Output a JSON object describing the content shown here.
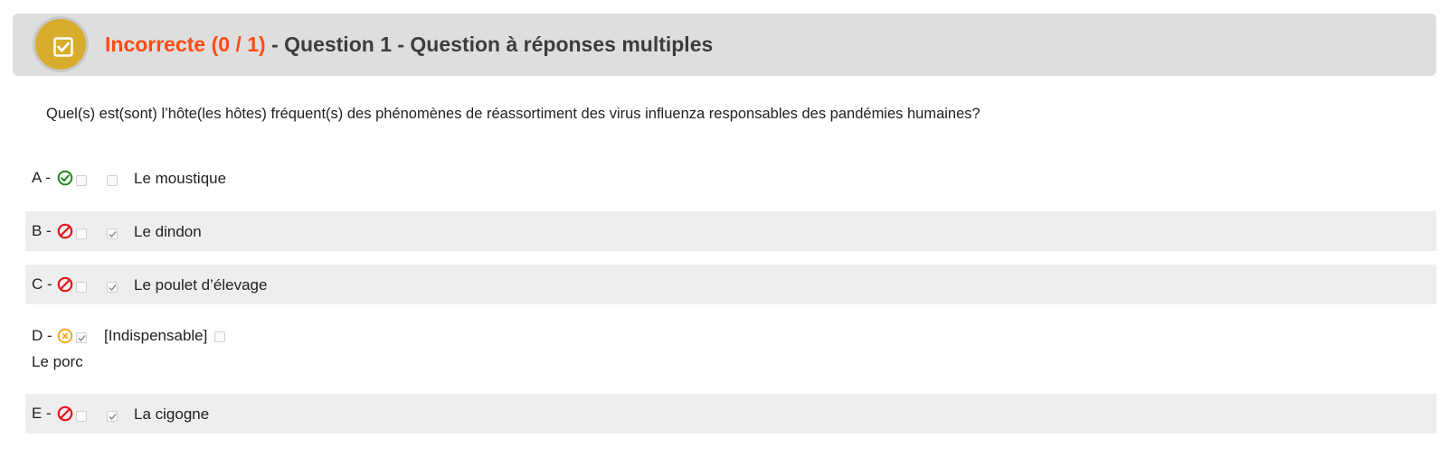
{
  "header": {
    "status": "Incorrecte (0 / 1)",
    "title_rest": " - Question 1 - Question à réponses multiples",
    "badge_icon": "checkbox-checked-icon",
    "badge_color": "#d8ad2e",
    "status_color": "#ff4c12"
  },
  "question": {
    "text": "Quel(s) est(sont) l’hôte(les hôtes) fréquent(s) des phénomènes de réassortiment des virus influenza responsables des pandémies humaines?"
  },
  "options": [
    {
      "letter": "A - ",
      "result_icon": "check-circle-icon",
      "result_color": "#1a8a1a",
      "expected_checked": false,
      "user_checked": false,
      "label": "Le moustique"
    },
    {
      "letter": "B - ",
      "result_icon": "forbidden-icon",
      "result_color": "#e8141a",
      "expected_checked": false,
      "user_checked": true,
      "label": "Le dindon"
    },
    {
      "letter": "C - ",
      "result_icon": "forbidden-icon",
      "result_color": "#e8141a",
      "expected_checked": false,
      "user_checked": true,
      "label": "Le poulet d’élevage"
    },
    {
      "letter": "D - ",
      "result_icon": "x-circle-icon",
      "result_color": "#f5a623",
      "expected_checked": true,
      "tag": "[Indispensable]",
      "user_checked": false,
      "label": "Le porc"
    },
    {
      "letter": "E - ",
      "result_icon": "forbidden-icon",
      "result_color": "#e8141a",
      "expected_checked": false,
      "user_checked": true,
      "label": "La cigogne"
    }
  ]
}
